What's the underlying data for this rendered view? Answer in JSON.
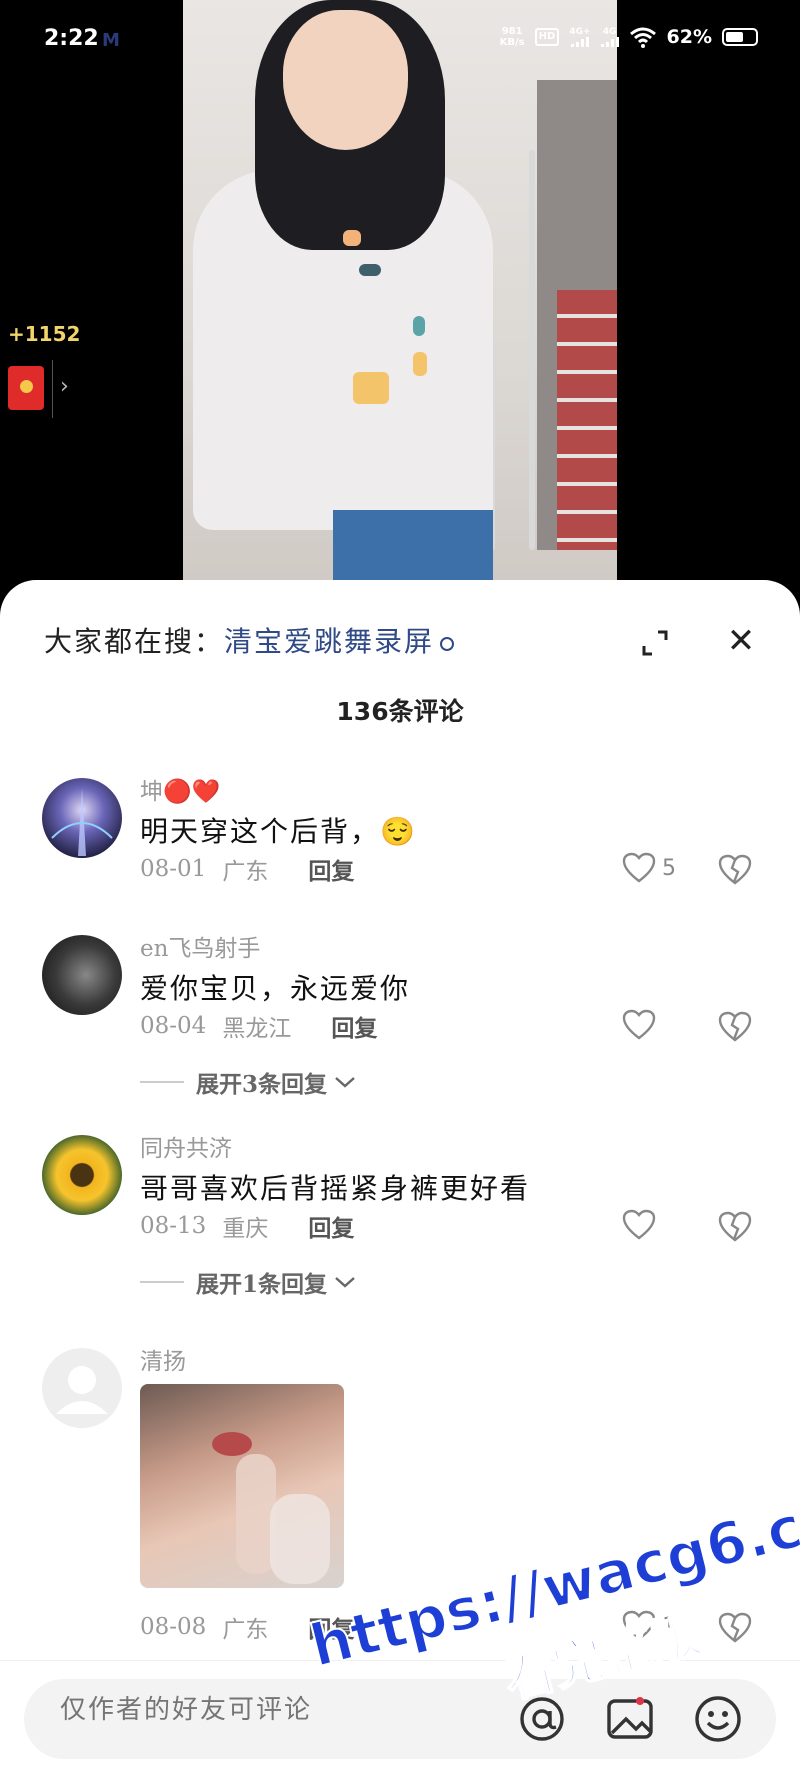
{
  "status_bar": {
    "time": "2:22",
    "app_icon": "M",
    "net_speed_value": "981",
    "net_speed_unit": "KB/s",
    "hd_label": "HD",
    "sim1_label": "4G+",
    "sim2_label": "4G",
    "battery_percent": "62%",
    "battery_level": 0.62
  },
  "overlay": {
    "coin_count": "+1152",
    "redpacket_arrow": "›"
  },
  "sheet": {
    "search_prefix": "大家都在搜：",
    "search_link": "清宝爱跳舞录屏",
    "close_glyph": "✕",
    "comment_count_label": "136条评论"
  },
  "comments": [
    {
      "username": "坤🔴❤️",
      "text": "明天穿这个后背，😌",
      "date": "08-01",
      "location": "广东",
      "reply_label": "回复",
      "likes": "5"
    },
    {
      "username": "en飞鸟射手",
      "text": "爱你宝贝，永远爱你",
      "date": "08-04",
      "location": "黑龙江",
      "reply_label": "回复",
      "likes": "",
      "expand_label": "展开3条回复"
    },
    {
      "username": "同舟共济",
      "text": "哥哥喜欢后背摇紧身裤更好看",
      "date": "08-13",
      "location": "重庆",
      "reply_label": "回复",
      "likes": "",
      "expand_label": "展开1条回复"
    },
    {
      "username": "清扬",
      "text": "",
      "date": "08-08",
      "location": "广东",
      "reply_label": "回复",
      "likes": "1"
    }
  ],
  "input_bar": {
    "placeholder": "仅作者的好友可评论"
  },
  "watermark": {
    "line1": "https://wacg6.com",
    "line2": "看完整版"
  },
  "colors": {
    "link_blue": "#2f4a86",
    "coin_gold": "#f1d46b",
    "watermark_blue": "#1e3fd6",
    "redpacket_red": "#e02b2b"
  },
  "icons": [
    "search-icon",
    "expand-icon",
    "close-icon",
    "heart-icon",
    "dislike-heart-icon",
    "chevron-down-icon",
    "at-icon",
    "image-icon",
    "emoji-icon",
    "wifi-icon",
    "battery-icon"
  ]
}
